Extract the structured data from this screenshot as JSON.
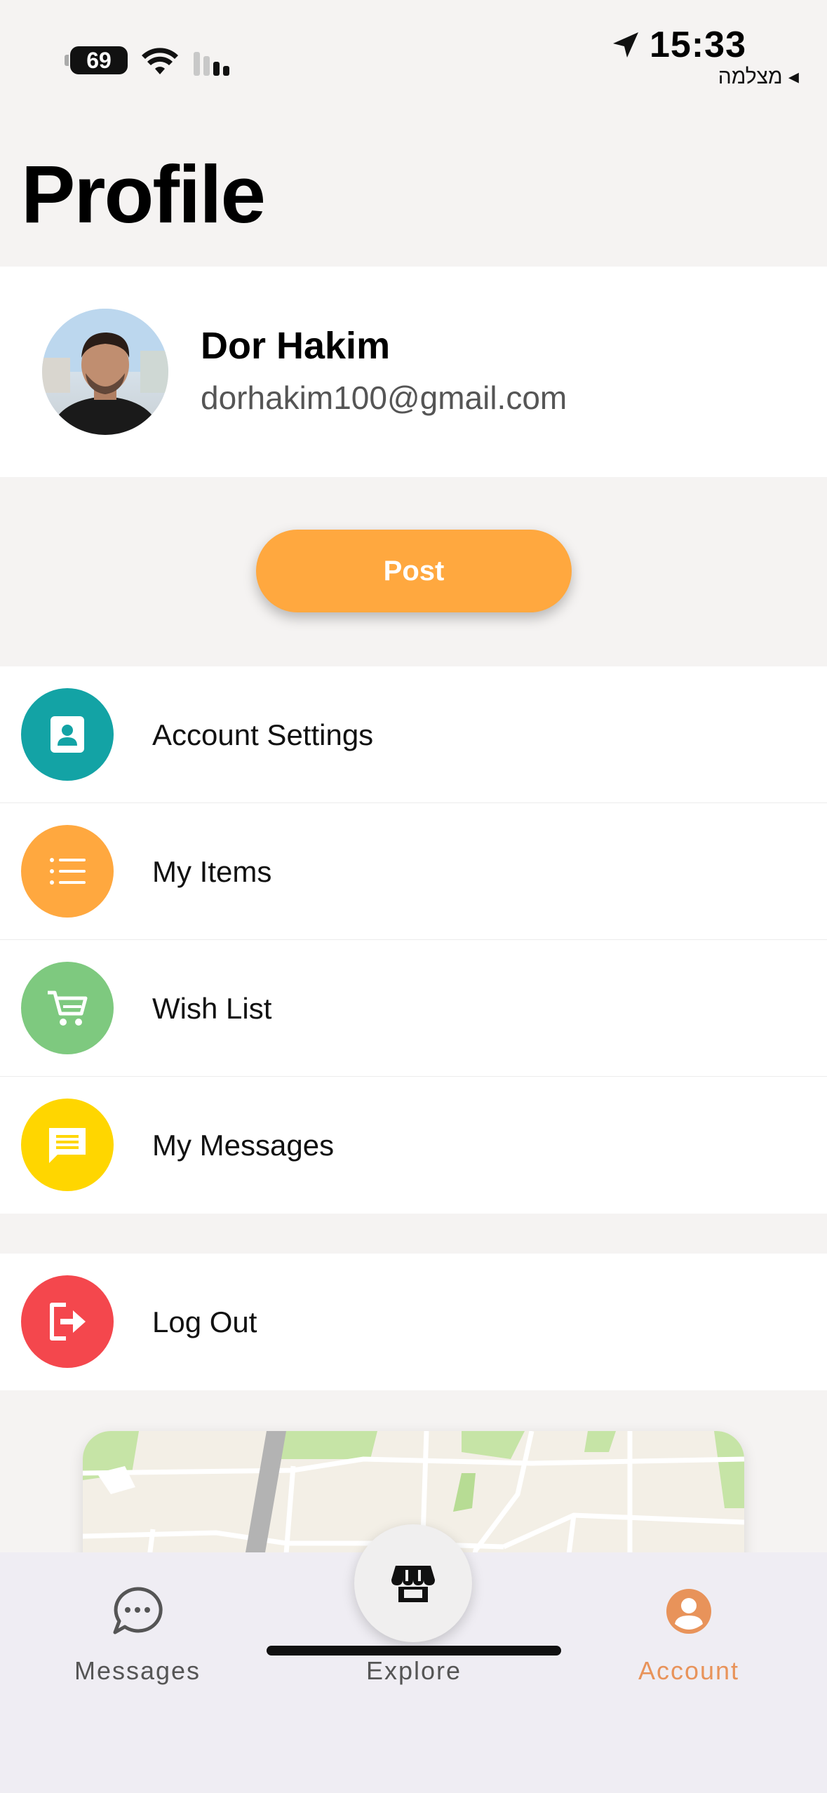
{
  "status_bar": {
    "battery": "69",
    "time": "15:33",
    "carrier": "מצלמה ◂"
  },
  "page": {
    "title": "Profile"
  },
  "profile": {
    "name": "Dor Hakim",
    "email": "dorhakim100@gmail.com"
  },
  "actions": {
    "post_label": "Post"
  },
  "menu": {
    "items": [
      {
        "label": "Account Settings",
        "icon": "contact-card-icon",
        "color": "#13a3a5"
      },
      {
        "label": "My Items",
        "icon": "list-icon",
        "color": "#ffa83f"
      },
      {
        "label": "Wish List",
        "icon": "cart-icon",
        "color": "#7ec97f"
      },
      {
        "label": "My Messages",
        "icon": "message-icon",
        "color": "#ffd600"
      }
    ],
    "logout": {
      "label": "Log Out",
      "icon": "logout-icon",
      "color": "#f4474d"
    }
  },
  "tab_bar": {
    "tabs": [
      {
        "label": "Messages",
        "icon": "chat-bubble-icon"
      },
      {
        "label": "Explore",
        "icon": "store-icon"
      },
      {
        "label": "Account",
        "icon": "account-icon",
        "active": true
      }
    ],
    "active_color": "#e8935a"
  }
}
